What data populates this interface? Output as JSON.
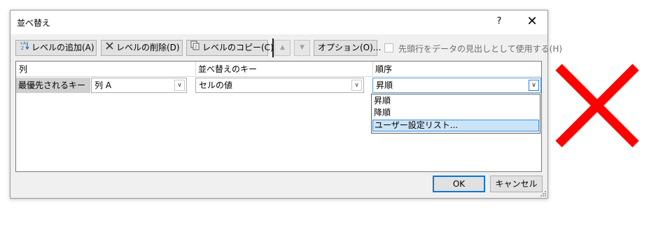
{
  "dialog": {
    "title": "並べ替え",
    "help": "?",
    "close": "✕"
  },
  "toolbar": {
    "add_level": "レベルの追加(A)",
    "delete_level": "レベルの削除(D)",
    "copy_level": "レベルのコピー(C)",
    "move_up": "▲",
    "move_down": "▼",
    "options": "オプション(O)...",
    "header_checkbox_label": "先頭行をデータの見出しとして使用する(H)",
    "header_checkbox_checked": false
  },
  "grid": {
    "headers": [
      "列",
      "並べ替えのキー",
      "順序"
    ],
    "row": {
      "label": "最優先されるキー",
      "column_value": "列 A",
      "sort_on_value": "セルの値",
      "order_value": "昇順"
    }
  },
  "order_dropdown": {
    "options": [
      "昇順",
      "降順",
      "ユーザー設定リスト..."
    ],
    "highlighted": "ユーザー設定リスト..."
  },
  "footer": {
    "ok": "OK",
    "cancel": "キャンセル"
  },
  "overlay": {
    "mark": "cross",
    "color": "#ff0000"
  },
  "colors": {
    "accent": "#0078d7",
    "highlight": "#cce4f7"
  }
}
